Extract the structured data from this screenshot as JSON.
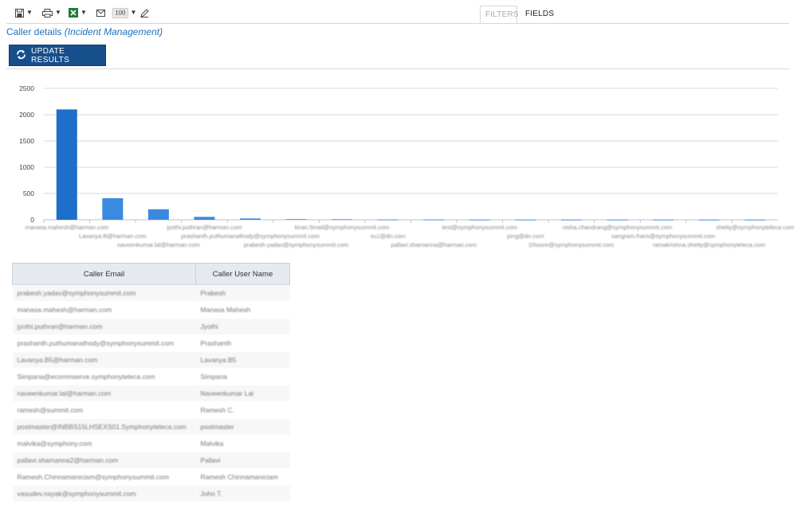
{
  "toolbar": {
    "icons": [
      "save-icon",
      "print-icon",
      "excel-icon",
      "mail-icon",
      "zoom-select",
      "edit-icon"
    ],
    "zoom_value": "100"
  },
  "tabs": [
    {
      "label": "FILTERS",
      "active": false
    },
    {
      "label": "FIELDS",
      "active": true
    }
  ],
  "page": {
    "title": "Caller details",
    "subtitle": "(Incident Management)"
  },
  "update_button": {
    "label": "UPDATE RESULTS",
    "icon": "refresh-icon",
    "color": "#174f8c"
  },
  "chart_data": {
    "type": "bar",
    "ylim": [
      0,
      2500
    ],
    "yticks": [
      "0",
      "500",
      "1000",
      "1500",
      "2000",
      "2500"
    ],
    "grid": true,
    "bar_color": "#1e6fc9",
    "categories": [
      "manasa.mahesh@harman.com",
      "Lavanya.B@harman.com",
      "naveenkumar.lal@harman.com",
      "jyothi.puthran@harman.com",
      "prashanth.puthumanathody@symphonysummit.com",
      "prabesh.yadav@symphonysummit.com",
      "kiran.5mail@symphonysummit.com",
      "xu1@dn.com",
      "pallavi.shamanna@harman.com",
      "test@symphonysummit.com",
      "ping@dn.com",
      "Dhoore@symphonysummit.com",
      "nisha.chandrang@symphonysummit.com",
      "sangram.frans@symphonysummit.com",
      "ramakrishna.shetty@symphonyteleca.com",
      "shetty@symphonyteleca.com"
    ],
    "values": [
      2100,
      410,
      200,
      55,
      25,
      12,
      10,
      4,
      3,
      2,
      2,
      2,
      1,
      1,
      1,
      1
    ]
  },
  "table": {
    "headers": [
      "Caller Email",
      "Caller User Name"
    ],
    "rows": [
      [
        "prabesh.yadav@symphonysummit.com",
        "Prabesh"
      ],
      [
        "manasa.mahesh@harman.com",
        "Manasa Mahesh"
      ],
      [
        "jyothi.puthran@harman.com",
        "Jyothi"
      ],
      [
        "prashanth.puthumanathody@symphonysummit.com",
        "Prashanth"
      ],
      [
        "Lavanya.B5@harman.com",
        "Lavanya.B5"
      ],
      [
        "Simpana@ecommserve.symphonyteleca.com",
        "Simpana"
      ],
      [
        "naveenkumar.lal@harman.com",
        "Naveenkumar Lal"
      ],
      [
        "ramesh@summit.com",
        "Ramesh C."
      ],
      [
        "postmaster@INBBS15LHSEXS01.Symphonyteleca.com",
        "postmaster"
      ],
      [
        "malvika@symphony.com",
        "Malvika"
      ],
      [
        "pallavi.shamanna2@harman.com",
        "Pallavi"
      ],
      [
        "Ramesh.Chinnamaniciam@symphonysummit.com",
        "Ramesh Chinnamaniciam"
      ],
      [
        "vasudev.nayak@symphonysummit.com",
        "John T."
      ]
    ]
  }
}
